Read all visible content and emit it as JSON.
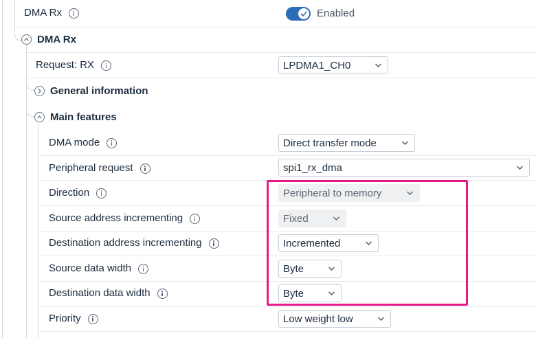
{
  "top": {
    "label": "DMA Rx",
    "toggle_state": "Enabled"
  },
  "dma_rx_section": {
    "title": "DMA Rx"
  },
  "request": {
    "label": "Request: RX",
    "value": "LPDMA1_CH0"
  },
  "general_info": {
    "title": "General information"
  },
  "main_features": {
    "title": "Main features",
    "rows": [
      {
        "label": "DMA mode",
        "value": "Direct transfer mode"
      },
      {
        "label": "Peripheral request",
        "value": "spi1_rx_dma"
      },
      {
        "label": "Direction",
        "value": "Peripheral to memory"
      },
      {
        "label": "Source address incrementing",
        "value": "Fixed"
      },
      {
        "label": "Destination address incrementing",
        "value": "Incremented"
      },
      {
        "label": "Source data width",
        "value": "Byte"
      },
      {
        "label": "Destination data width",
        "value": "Byte"
      },
      {
        "label": "Priority",
        "value": "Low weight low"
      }
    ]
  },
  "colors": {
    "accent": "#2d6db5",
    "highlight": "#e8188a"
  }
}
